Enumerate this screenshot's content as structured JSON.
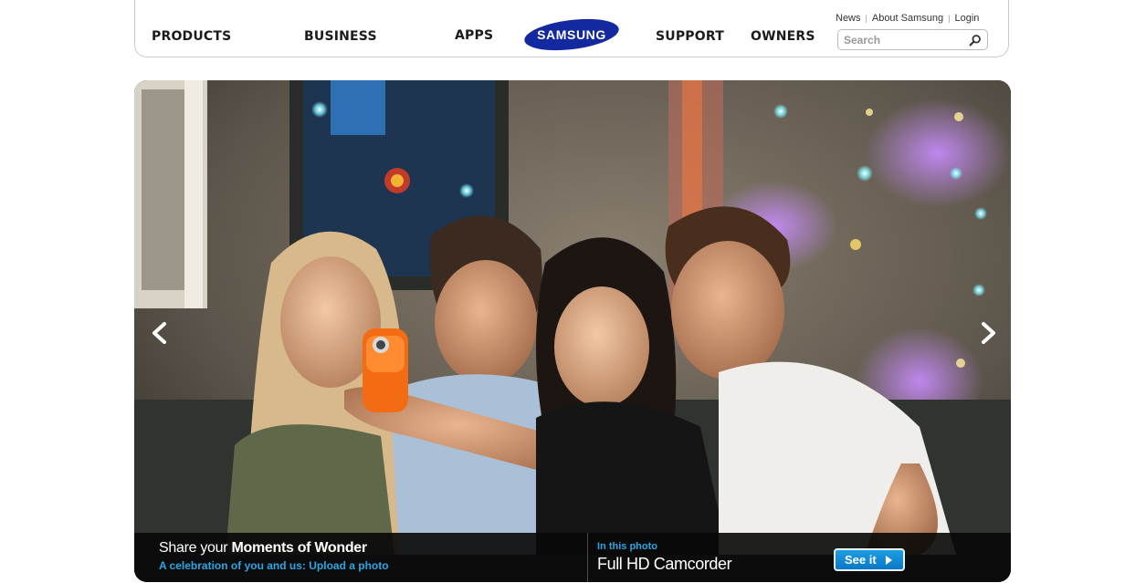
{
  "nav": {
    "items": [
      "PRODUCTS",
      "BUSINESS",
      "APPS",
      "SUPPORT",
      "OWNERS"
    ],
    "logo_text": "SAMSUNG"
  },
  "utility": {
    "news": "News",
    "about": "About Samsung",
    "login": "Login",
    "separator": "|"
  },
  "search": {
    "placeholder": "Search"
  },
  "hero": {
    "share_prefix": "Share your",
    "share_bold": "Moments of Wonder",
    "upload_text": "A celebration of you and us: Upload a photo",
    "in_photo_label": "In this photo",
    "product_name": "Full HD Camcorder",
    "see_it_label": "See it"
  },
  "colors": {
    "brand_blue": "#1428a0",
    "link_blue": "#2aa6e6",
    "button_blue": "#0b78c4",
    "caption_bg": "#080808"
  },
  "icons": {
    "search": "magnifier-icon",
    "prev": "chevron-left-icon",
    "next": "chevron-right-icon",
    "play": "play-triangle-icon"
  }
}
